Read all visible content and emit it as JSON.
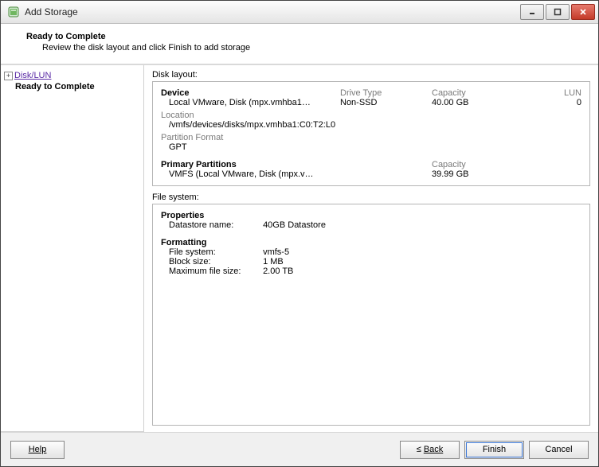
{
  "window": {
    "title": "Add Storage"
  },
  "header": {
    "title": "Ready to Complete",
    "subtitle": "Review the disk layout and click Finish to add storage"
  },
  "nav": {
    "disk_lun": "Disk/LUN",
    "ready": "Ready to Complete"
  },
  "disk_layout": {
    "section_label": "Disk layout:",
    "headers": {
      "device": "Device",
      "drive_type": "Drive Type",
      "capacity": "Capacity",
      "lun": "LUN"
    },
    "device": {
      "name": "Local VMware, Disk (mpx.vmhba1…",
      "drive_type": "Non-SSD",
      "capacity": "40.00 GB",
      "lun": "0"
    },
    "location_label": "Location",
    "location_value": "/vmfs/devices/disks/mpx.vmhba1:C0:T2:L0",
    "partition_format_label": "Partition Format",
    "partition_format_value": "GPT",
    "primary_partitions_label": "Primary Partitions",
    "primary_capacity_header": "Capacity",
    "partition": {
      "name": "VMFS (Local VMware, Disk (mpx.v…",
      "capacity": "39.99 GB"
    }
  },
  "file_system": {
    "section_label": "File system:",
    "properties_label": "Properties",
    "datastore_name_label": "Datastore name:",
    "datastore_name": "40GB Datastore",
    "formatting_label": "Formatting",
    "fs_label": "File system:",
    "fs_value": "vmfs-5",
    "block_label": "Block size:",
    "block_value": "1 MB",
    "max_label": "Maximum file size:",
    "max_value": "2.00 TB"
  },
  "footer": {
    "help": "Help",
    "back_prefix": "≤ ",
    "back": "Back",
    "finish": "Finish",
    "cancel": "Cancel"
  }
}
